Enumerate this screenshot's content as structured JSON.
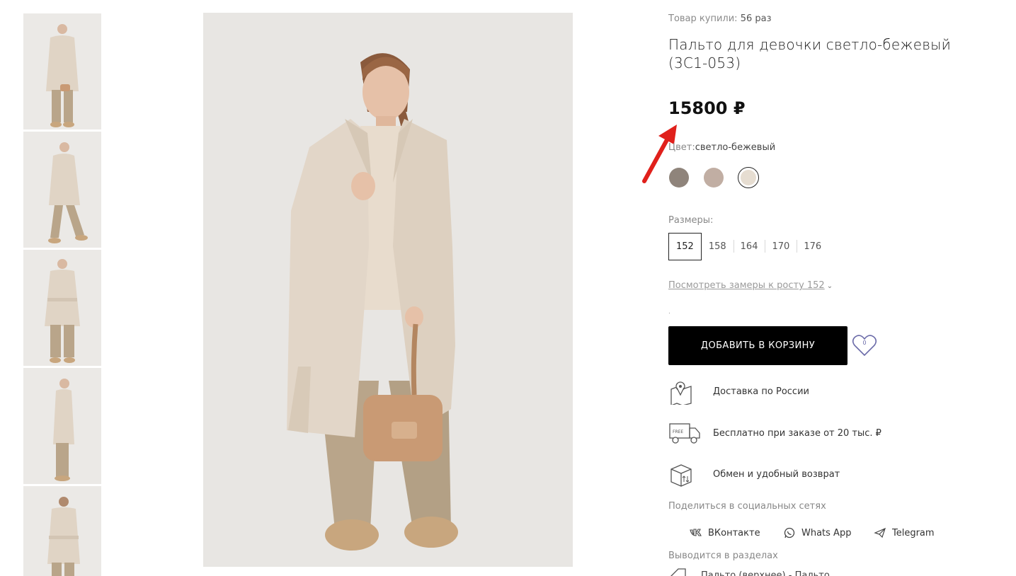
{
  "product": {
    "sold_label": "Товар купили:",
    "sold_count": "56 раз",
    "title": "Пальто для девочки светло-бежевый (3С1-053)",
    "price": "15800 ₽",
    "color_label": "Цвет:",
    "color_value": "светло-бежевый",
    "swatches": [
      {
        "name": "grey-brown",
        "color": "#8f847b"
      },
      {
        "name": "beige",
        "color": "#c1aea3"
      },
      {
        "name": "light-beige",
        "color": "#e6ddd1",
        "selected": true
      }
    ],
    "sizes_label": "Размеры:",
    "sizes": [
      "152",
      "158",
      "164",
      "170",
      "176"
    ],
    "selected_size": "152",
    "measure_link": "Посмотреть замеры к росту 152",
    "tiny_dot": ".",
    "add_to_cart": "ДОБАВИТЬ В КОРЗИНУ",
    "favorites_count": "0"
  },
  "features": [
    {
      "icon": "map-pin-icon",
      "text": "Доставка по России"
    },
    {
      "icon": "delivery-truck-icon",
      "text": "Бесплатно при заказе от 20 тыс. ₽"
    },
    {
      "icon": "box-return-icon",
      "text": "Обмен и удобный возврат"
    }
  ],
  "truck_badge": "FREE",
  "share": {
    "label": "Поделиться в социальных сетях",
    "links": [
      {
        "icon": "vk-icon",
        "label": "ВКонтакте"
      },
      {
        "icon": "whatsapp-icon",
        "label": "Whats App"
      },
      {
        "icon": "telegram-icon",
        "label": "Telegram"
      }
    ]
  },
  "sections": {
    "label": "Выводится в разделах",
    "link": "Пальто (верхнее) - Пальто"
  },
  "colors": {
    "accent": "#000000",
    "arrow": "#e0201b",
    "favorite": "#6a6aa8",
    "photo_bg": "#e8e6e3",
    "coat": "#e2d6c8",
    "pants": "#b9a58a",
    "bag": "#c99a74"
  }
}
